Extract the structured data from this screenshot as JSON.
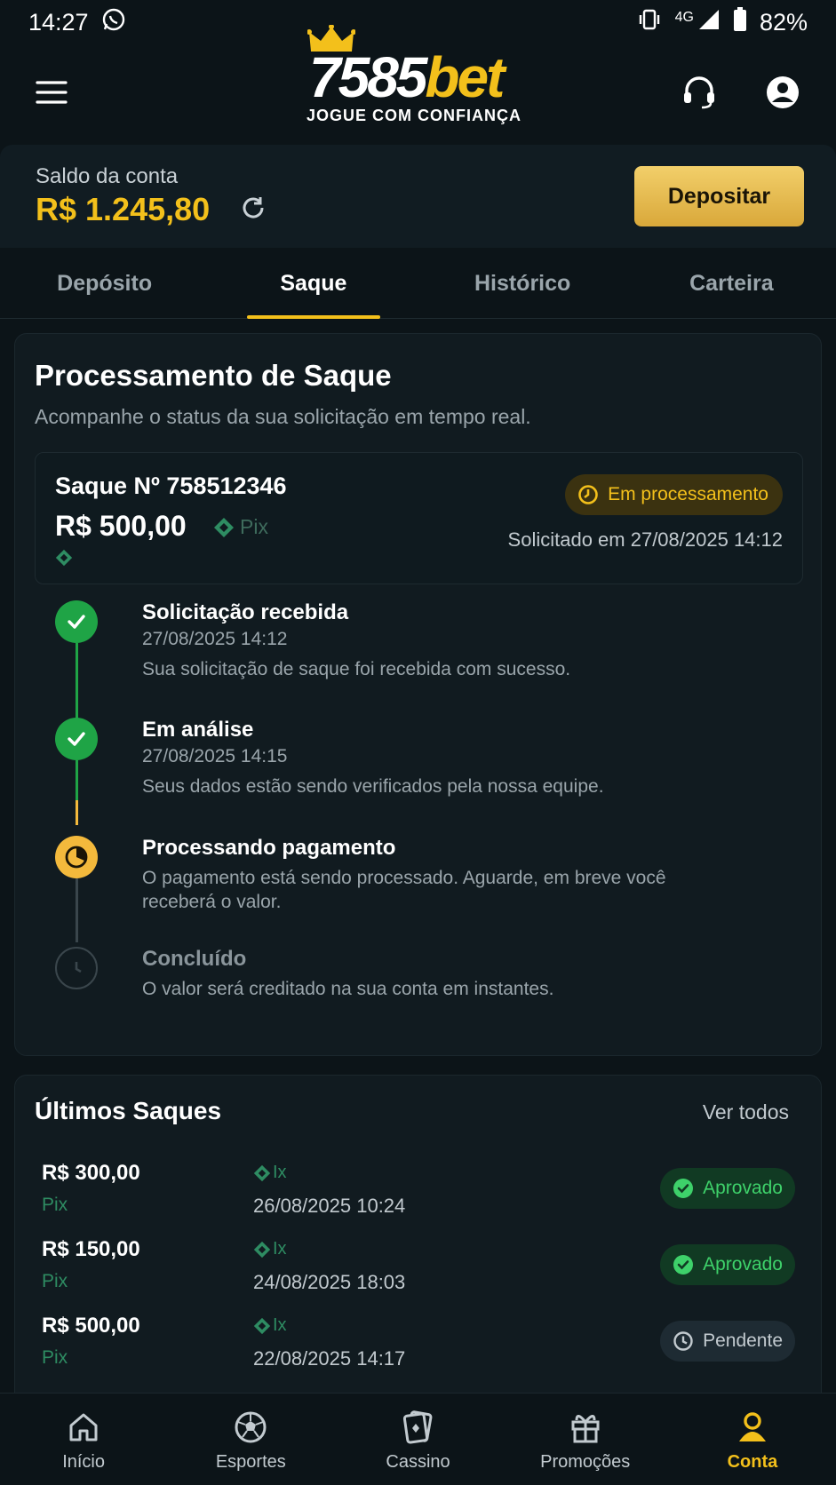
{
  "status_bar": {
    "time": "14:27",
    "network": "4G",
    "battery": "82%"
  },
  "brand": {
    "logo_num": "7585",
    "logo_bet": "bet",
    "tagline": "JOGUE COM CONFIANÇA"
  },
  "balance": {
    "label": "Saldo da conta",
    "value": "R$ 1.245,80",
    "deposit_label": "Depositar"
  },
  "tabs": [
    {
      "label": "Depósito",
      "active": false
    },
    {
      "label": "Saque",
      "active": true
    },
    {
      "label": "Histórico",
      "active": false
    },
    {
      "label": "Carteira",
      "active": false
    }
  ],
  "processing": {
    "title": "Processamento de Saque",
    "subtitle": "Acompanhe o status da sua solicitação em tempo real.",
    "withdrawal": {
      "number": "Saque Nº 758512346",
      "amount": "R$ 500,00",
      "method": "Pix",
      "status": "Em processamento",
      "requested": "Solicitado em 27/08/2025 14:12"
    },
    "steps": [
      {
        "title": "Solicitação recebida",
        "time": "27/08/2025 14:12",
        "desc": "Sua solicitação de saque foi recebida com sucesso.",
        "state": "done"
      },
      {
        "title": "Em análise",
        "time": "27/08/2025 14:15",
        "desc": "Seus dados estão sendo verificados pela nossa equipe.",
        "state": "done"
      },
      {
        "title": "Processando pagamento",
        "time": "",
        "desc": "O pagamento está sendo processado. Aguarde, em breve você receberá o valor.",
        "state": "current"
      },
      {
        "title": "Concluído",
        "time": "",
        "desc": "O valor será creditado na sua conta em instantes.",
        "state": "pending"
      }
    ]
  },
  "recent": {
    "title": "Últimos Saques",
    "view_all": "Ver todos",
    "rows": [
      {
        "amount": "R$ 300,00",
        "method": "Pix",
        "mini": "Ix",
        "date": "26/08/2025 10:24",
        "status": "Aprovado"
      },
      {
        "amount": "R$ 150,00",
        "method": "Pix",
        "mini": "Ix",
        "date": "24/08/2025 18:03",
        "status": "Aprovado"
      },
      {
        "amount": "R$ 500,00",
        "method": "Pix",
        "mini": "Ix",
        "date": "22/08/2025 14:17",
        "status": "Pendente"
      }
    ]
  },
  "bottom_nav": [
    {
      "label": "Início",
      "icon": "home-icon",
      "active": false
    },
    {
      "label": "Esportes",
      "icon": "soccer-ball-icon",
      "active": false
    },
    {
      "label": "Cassino",
      "icon": "cards-icon",
      "active": false
    },
    {
      "label": "Promoções",
      "icon": "gift-icon",
      "active": false
    },
    {
      "label": "Conta",
      "icon": "user-icon",
      "active": true
    }
  ],
  "colors": {
    "accent": "#f3c01b",
    "success": "#1fa446",
    "background": "#0c1418",
    "card": "#111b20"
  }
}
